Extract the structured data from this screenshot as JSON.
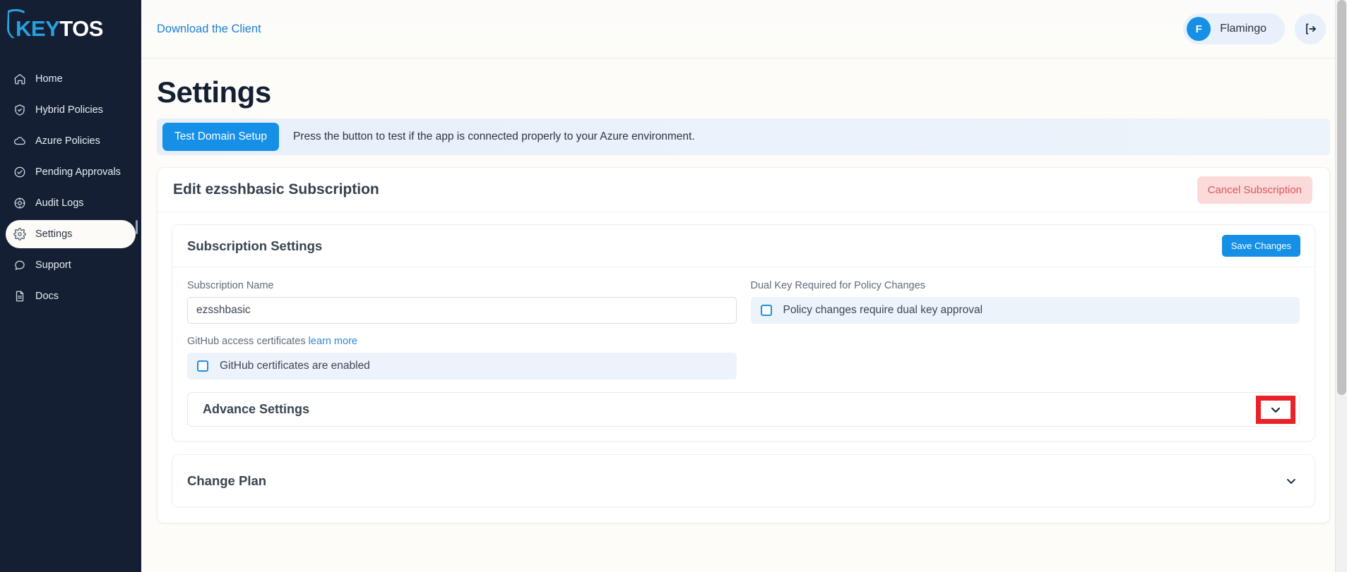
{
  "brand": {
    "logo_primary": "KEY",
    "logo_secondary": "TOS",
    "accent_color": "#29a0e0",
    "sidebar_bg": "#141f33"
  },
  "sidebar": {
    "items": [
      {
        "label": "Home",
        "icon": "home-icon",
        "active": false
      },
      {
        "label": "Hybrid Policies",
        "icon": "shield-check-icon",
        "active": false
      },
      {
        "label": "Azure Policies",
        "icon": "cloud-icon",
        "active": false
      },
      {
        "label": "Pending Approvals",
        "icon": "check-circle-icon",
        "active": false
      },
      {
        "label": "Audit Logs",
        "icon": "target-icon",
        "active": false
      },
      {
        "label": "Settings",
        "icon": "gear-icon",
        "active": true
      },
      {
        "label": "Support",
        "icon": "chat-bubble-icon",
        "active": false
      },
      {
        "label": "Docs",
        "icon": "document-icon",
        "active": false
      }
    ]
  },
  "topbar": {
    "download_link": "Download the Client",
    "user_initial": "F",
    "user_name": "Flamingo",
    "logout_icon": "logout-icon"
  },
  "page": {
    "title": "Settings"
  },
  "notice": {
    "button_label": "Test Domain Setup",
    "text": "Press the button to test if the app is connected properly to your Azure environment."
  },
  "subscription_panel": {
    "title": "Edit ezsshbasic Subscription",
    "cancel_label": "Cancel Subscription",
    "cancel_color": "#e0555b"
  },
  "settings_card": {
    "title": "Subscription Settings",
    "save_label": "Save Changes",
    "fields": {
      "subscription_name_label": "Subscription Name",
      "subscription_name_value": "ezsshbasic",
      "subscription_name_placeholder": "Subscription Name",
      "dual_key_label": "Dual Key Required for Policy Changes",
      "dual_key_check_label": "Policy changes require dual key approval",
      "dual_key_checked": false,
      "github_label": "GitHub access certificates",
      "github_link": "learn more",
      "github_check_label": "GitHub certificates are enabled",
      "github_checked": false
    },
    "advance_settings_label": "Advance Settings"
  },
  "change_plan": {
    "title": "Change Plan"
  },
  "annotation": {
    "highlight_color": "#ea2227",
    "highlight_target": "advance-settings-chevron"
  }
}
